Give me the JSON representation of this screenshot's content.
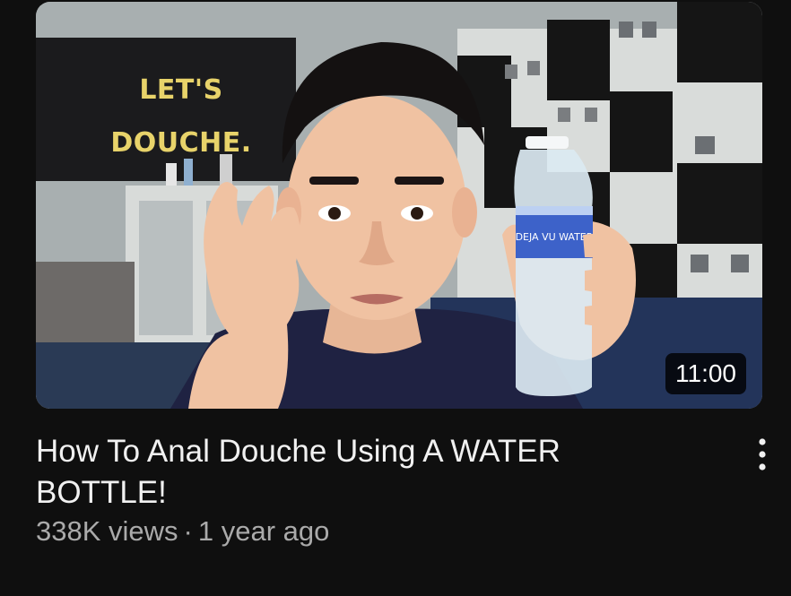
{
  "video": {
    "thumbnail_caption": "LET'S\nDOUCHE.",
    "bottle_label": "DEJA VU WATER",
    "duration": "11:00",
    "title": "How To Anal Douche Using A WATER BOTTLE!",
    "views": "338K views",
    "separator": "·",
    "age": "1 year ago",
    "more_icon": "more-vertical-icon"
  },
  "colors": {
    "background": "#0f0f0f",
    "title_text": "#f1f1f1",
    "meta_text": "#aaaaaa",
    "duration_bg": "#000000",
    "caption_text": "#e8d36a"
  }
}
